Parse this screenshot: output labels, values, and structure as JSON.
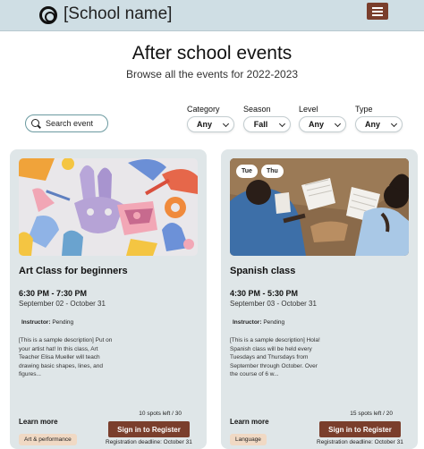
{
  "header": {
    "school_name": "[School name]"
  },
  "page": {
    "title": "After school events",
    "subtitle": "Browse all the events for 2022-2023"
  },
  "search": {
    "placeholder": "Search event"
  },
  "filters": [
    {
      "label": "Category",
      "value": "Any"
    },
    {
      "label": "Season",
      "value": "Fall"
    },
    {
      "label": "Level",
      "value": "Any"
    },
    {
      "label": "Type",
      "value": "Any"
    }
  ],
  "events": [
    {
      "title": "Art Class for beginners",
      "time": "6:30 PM - 7:30 PM",
      "dates": "September 02 - October 31",
      "instructor_label": "Instructor:",
      "instructor": "Pending",
      "description": "[This is a sample description] Put on your artist hat! In this class, Art Teacher Elisa Mueller will teach drawing basic shapes, lines, and figures...",
      "learn_more": "Learn more",
      "category": "Art & performance",
      "spots": "10 spots left / 30",
      "register": "Sign in to Register",
      "deadline": "Registration deadline: October 31",
      "days": []
    },
    {
      "title": "Spanish class",
      "time": "4:30 PM - 5:30 PM",
      "dates": "September 03 - October 31",
      "instructor_label": "Instructor:",
      "instructor": "Pending",
      "description": "[This is a sample description] Hola! Spanish class will be held every Tuesdays and Thursdays from September through October. Over the course of 6 w...",
      "learn_more": "Learn more",
      "category": "Language",
      "spots": "15 spots left / 20",
      "register": "Sign in to Register",
      "deadline": "Registration deadline: October 31",
      "days": [
        "Tue",
        "Thu"
      ]
    }
  ]
}
